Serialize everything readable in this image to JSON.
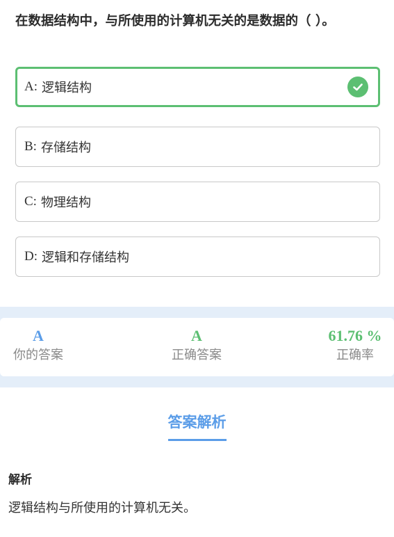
{
  "question": {
    "text": "在数据结构中，与所使用的计算机无关的是数据的（  ）。"
  },
  "options": [
    {
      "letter": "A:",
      "text": "逻辑结构",
      "state": "correct"
    },
    {
      "letter": "B:",
      "text": "存储结构",
      "state": "normal"
    },
    {
      "letter": "C:",
      "text": "物理结构",
      "state": "normal"
    },
    {
      "letter": "D:",
      "text": "逻辑和存储结构",
      "state": "normal"
    }
  ],
  "stats": {
    "your_answer": {
      "value": "A",
      "label": "你的答案"
    },
    "correct_answer": {
      "value": "A",
      "label": "正确答案"
    },
    "accuracy": {
      "value": "61.76 %",
      "label": "正确率"
    }
  },
  "analysis": {
    "section_title": "答案解析",
    "heading": "解析",
    "body": "逻辑结构与所使用的计算机无关。"
  },
  "colors": {
    "correct": "#5cbf72",
    "accent": "#5b9de8",
    "band": "#e4eef9"
  },
  "icons": {
    "correct_mark": "check-circle-icon"
  }
}
